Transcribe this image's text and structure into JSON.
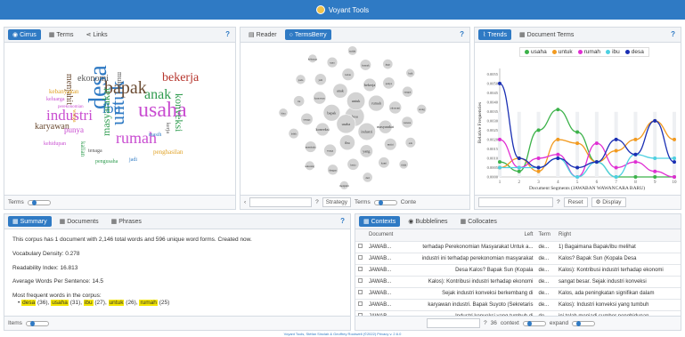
{
  "app": {
    "title": "Voyant Tools",
    "footer": "Voyant Tools, Stéfan Sinclair & Geoffrey Rockwell (©2022) Privacy v. 2.6.0"
  },
  "cirrus": {
    "tabs": [
      "Cirrus",
      "Terms",
      "Links"
    ],
    "help": "?",
    "terms_label": "Terms",
    "words": [
      {
        "t": "desa",
        "c": "#2f7ac4"
      },
      {
        "t": "usaha",
        "c": "#c94ed1"
      },
      {
        "t": "untuk",
        "c": "#2f7ac4"
      },
      {
        "t": "industri",
        "c": "#c94ed1"
      },
      {
        "t": "bapak",
        "c": "#6b4b32"
      },
      {
        "t": "rumah",
        "c": "#c94ed1"
      },
      {
        "t": "anak",
        "c": "#2f9c4f"
      },
      {
        "t": "ibu",
        "c": "#2f7ac4"
      },
      {
        "t": "bekerja",
        "c": "#b5332b"
      },
      {
        "t": "masyarakat",
        "c": "#2f9c4f"
      },
      {
        "t": "konveksi",
        "c": "#2f9c4f"
      },
      {
        "t": "karyawan",
        "c": "#6b4b32"
      },
      {
        "t": "ekonomi",
        "c": "#555"
      },
      {
        "t": "menjahit",
        "c": "#6b4b32"
      },
      {
        "t": "punya",
        "c": "#c94ed1"
      },
      {
        "t": "mulai",
        "c": "#555"
      },
      {
        "t": "kebanyakan",
        "c": "#e0a123"
      },
      {
        "t": "penghasilan",
        "c": "#e0a123"
      },
      {
        "t": "kalian",
        "c": "#2f9c4f"
      },
      {
        "t": "keluarga",
        "c": "#c94ed1"
      },
      {
        "t": "tenaga",
        "c": "#555"
      },
      {
        "t": "masih",
        "c": "#2f7ac4"
      },
      {
        "t": "kerja",
        "c": "#555"
      },
      {
        "t": "warga",
        "c": "#e0a123"
      },
      {
        "t": "pengusaha",
        "c": "#2f9c4f"
      },
      {
        "t": "jadi",
        "c": "#2f7ac4"
      },
      {
        "t": "kehidupan",
        "c": "#c94ed1"
      },
      {
        "t": "perekonomian",
        "c": "#c94ed1"
      }
    ]
  },
  "termsberry": {
    "tabs": [
      "Reader",
      "TermsBerry"
    ],
    "help": "?",
    "strategy": "Strategy",
    "terms": "Terms",
    "context": "Conte",
    "bubbles": [
      "desa",
      "usaha",
      "untuk",
      "industri",
      "bapak",
      "rumah",
      "ibu",
      "anak",
      "masyarakat",
      "konveksi",
      "bekerja",
      "yang",
      "karyawan",
      "ekonomi",
      "warga",
      "kalau",
      "mulai",
      "tenaga",
      "punya",
      "kerja",
      "jadi",
      "karena",
      "membuka",
      "banyak",
      "kami",
      "itu",
      "sangat",
      "dengan",
      "saya",
      "ada",
      "lebih",
      "juga",
      "dari",
      "pada",
      "orang",
      "sekarang",
      "sudah",
      "tidak",
      "bisa",
      "baik",
      "menjahit",
      "keluarga"
    ]
  },
  "trends": {
    "tabs": [
      "Trends",
      "Document Terms"
    ],
    "help": "?",
    "reset": "Reset",
    "display": "Display",
    "xlabel": "Document Segments (JAWABAN WAWANCARA BARU)",
    "ylabel": "Relative Frequencies"
  },
  "chart_data": {
    "type": "line",
    "x": [
      1,
      2,
      3,
      4,
      5,
      6,
      7,
      8,
      9,
      10
    ],
    "yticks": [
      "0.0000",
      "0.0005",
      "0.0010",
      "0.0015",
      "0.0020",
      "0.0025",
      "0.0030",
      "0.0035",
      "0.0040",
      "0.0045",
      "0.0050",
      "0.0055"
    ],
    "ylim": [
      0,
      0.0058
    ],
    "series": [
      {
        "name": "usaha",
        "color": "#3cb24a",
        "values": [
          0.0008,
          0.0003,
          0.0025,
          0.0036,
          0.0024,
          0.0008,
          0.0,
          0.0,
          0.0,
          0.0
        ]
      },
      {
        "name": "untuk",
        "color": "#f29a1f",
        "values": [
          0.0005,
          0.001,
          0.0003,
          0.002,
          0.0018,
          0.0008,
          0.0014,
          0.002,
          0.003,
          0.002
        ]
      },
      {
        "name": "rumah",
        "color": "#e02fd3",
        "values": [
          0.002,
          0.0005,
          0.001,
          0.0012,
          0.0,
          0.0018,
          0.0005,
          0.0008,
          0.0003,
          0.0
        ]
      },
      {
        "name": "ibu",
        "color": "#4dd0e1",
        "values": [
          0.0005,
          0.0005,
          0.0005,
          0.001,
          0.0,
          0.0008,
          0.0,
          0.0012,
          0.001,
          0.001
        ]
      },
      {
        "name": "desa",
        "color": "#1a2fb3",
        "values": [
          0.005,
          0.001,
          0.0005,
          0.001,
          0.0005,
          0.0008,
          0.002,
          0.0012,
          0.003,
          0.0008
        ]
      }
    ]
  },
  "summary_panel": {
    "tabs": [
      "Summary",
      "Documents",
      "Phrases"
    ],
    "help": "?",
    "line1": "This corpus has 1 document with 2,146 total words and 596 unique word forms. Created now.",
    "density": "Vocabulary Density: 0.278",
    "readability": "Readability Index: 16.813",
    "avg": "Average Words Per Sentence: 14.5",
    "freq_title": "Most frequent words in the corpus:",
    "freq_words": [
      {
        "w": "desa",
        "n": " (36), "
      },
      {
        "w": "usaha",
        "n": " (31), "
      },
      {
        "w": "ibu",
        "n": " (27), "
      },
      {
        "w": "untuk",
        "n": " (26), "
      },
      {
        "w": "rumah",
        "n": " (25)"
      }
    ],
    "items_label": "Items"
  },
  "contexts": {
    "tabs": [
      "Contexts",
      "Bubblelines",
      "Collocates"
    ],
    "headers": [
      "Document",
      "Left",
      "Term",
      "Right"
    ],
    "rows": [
      {
        "doc": "JAWAB...",
        "left": "terhadap Perekonomian Masyarakat Untuk a...",
        "term": "de...",
        "right": "1) Bagaimana Bapak/ibu melihat"
      },
      {
        "doc": "JAWAB...",
        "left": "industri ini terhadap perekonomian masyarakat",
        "term": "de...",
        "right": "Kalos? Bapak Sun (Kopala Desa"
      },
      {
        "doc": "JAWAB...",
        "left": "Desa Kalos? Bapak Sun (Kopala",
        "term": "de...",
        "right": "Kalos): Kontribusi industri terhadap ekonomi"
      },
      {
        "doc": "JAWAB...",
        "left": "Kalos): Kontribusi industri terhadap ekonomi",
        "term": "de...",
        "right": "sangat besar. Sejak industri konveksi"
      },
      {
        "doc": "JAWAB...",
        "left": "Sejak industri konveksi berkembang di",
        "term": "de...",
        "right": "Kalos, ada peningkatan signifikan dalam"
      },
      {
        "doc": "JAWAB...",
        "left": "karyawan industri. Bapak Suyoto (Sekretaris",
        "term": "de...",
        "right": "Kalos): Industri konveksi yang tumbuh"
      },
      {
        "doc": "JAWAB...",
        "left": "Industri konveksi yang tumbuh di",
        "term": "de...",
        "right": "ini telah menjadi sumber penghidupan"
      }
    ],
    "help": "?",
    "count": "36",
    "context_label": "context",
    "expand_label": "expand"
  }
}
